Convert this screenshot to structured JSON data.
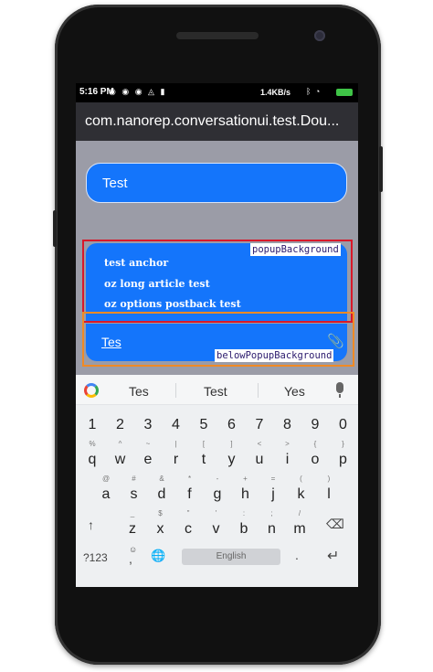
{
  "statusbar": {
    "time": "5:16 PM",
    "network_speed": "1.4KB/s"
  },
  "appbar": {
    "title": "com.nanorep.conversationui.test.Dou..."
  },
  "chat": {
    "bubble_text": "Test"
  },
  "popup": {
    "items": [
      "test anchor",
      "oz long article test",
      "oz options postback test"
    ]
  },
  "input": {
    "typed_text": "Tes"
  },
  "annotations": {
    "popup_label": "popupBackground",
    "below_label": "belowPopupBackground"
  },
  "colors": {
    "accent": "#1475fb",
    "red_frame": "#d9182a",
    "orange_frame": "#f08a24"
  },
  "keyboard": {
    "suggestions": [
      "Tes",
      "Test",
      "Yes"
    ],
    "numbers_row": [
      "1",
      "2",
      "3",
      "4",
      "5",
      "6",
      "7",
      "8",
      "9",
      "0"
    ],
    "row1": [
      {
        "key": "q",
        "hint": "%"
      },
      {
        "key": "w",
        "hint": "^"
      },
      {
        "key": "e",
        "hint": "~"
      },
      {
        "key": "r",
        "hint": "|"
      },
      {
        "key": "t",
        "hint": "["
      },
      {
        "key": "y",
        "hint": "]"
      },
      {
        "key": "u",
        "hint": "<"
      },
      {
        "key": "i",
        "hint": ">"
      },
      {
        "key": "o",
        "hint": "{"
      },
      {
        "key": "p",
        "hint": "}"
      }
    ],
    "row2": [
      {
        "key": "a",
        "hint": "@"
      },
      {
        "key": "s",
        "hint": "#"
      },
      {
        "key": "d",
        "hint": "&"
      },
      {
        "key": "f",
        "hint": "*"
      },
      {
        "key": "g",
        "hint": "-"
      },
      {
        "key": "h",
        "hint": "+"
      },
      {
        "key": "j",
        "hint": "="
      },
      {
        "key": "k",
        "hint": "("
      },
      {
        "key": "l",
        "hint": ")"
      }
    ],
    "row3": [
      {
        "key": "z",
        "hint": "_"
      },
      {
        "key": "x",
        "hint": "$"
      },
      {
        "key": "c",
        "hint": "\""
      },
      {
        "key": "v",
        "hint": "'"
      },
      {
        "key": "b",
        "hint": ":"
      },
      {
        "key": "n",
        "hint": ";"
      },
      {
        "key": "m",
        "hint": "/"
      }
    ],
    "symbols_label": "?123",
    "comma": ",",
    "period": ".",
    "space_label": "English",
    "shift_glyph": "↑",
    "backspace_glyph": "⌫",
    "enter_glyph": "↵",
    "emoji_glyph": "☺",
    "globe_glyph": "🌐",
    "clip_glyph": "📎"
  }
}
